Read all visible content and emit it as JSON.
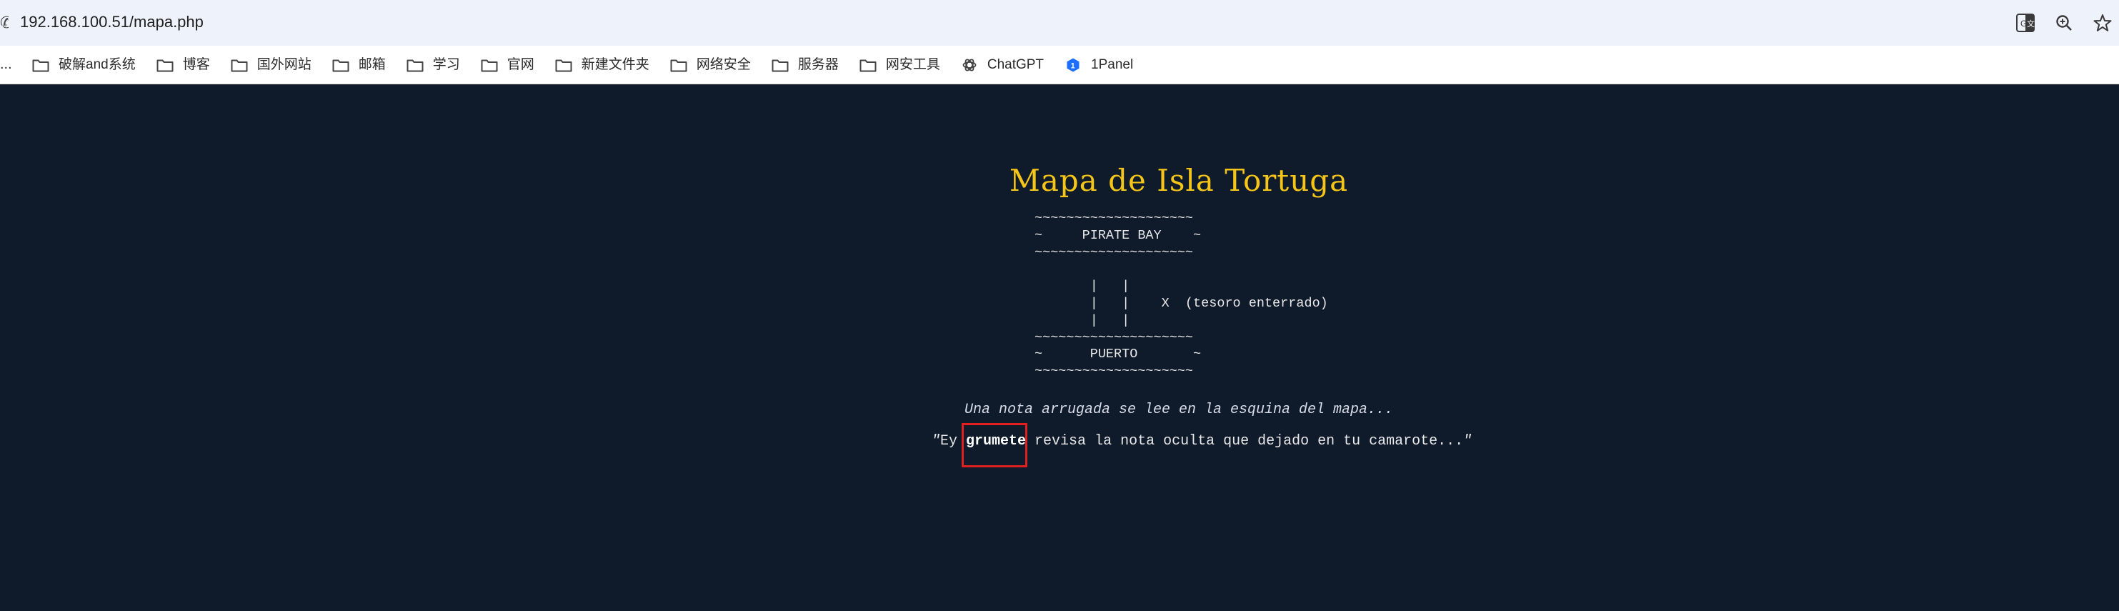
{
  "browser": {
    "url": "192.168.100.51/mapa.php",
    "address_icons": [
      "translate-icon",
      "zoom-icon",
      "bookmark-star-icon"
    ],
    "bookmarks_overflow": "...",
    "bookmarks": [
      {
        "label": "破解and系统",
        "icon": "folder-icon"
      },
      {
        "label": "博客",
        "icon": "folder-icon"
      },
      {
        "label": "国外网站",
        "icon": "folder-icon"
      },
      {
        "label": "邮箱",
        "icon": "folder-icon"
      },
      {
        "label": "学习",
        "icon": "folder-icon"
      },
      {
        "label": "官网",
        "icon": "folder-icon"
      },
      {
        "label": "新建文件夹",
        "icon": "folder-icon"
      },
      {
        "label": "网络安全",
        "icon": "folder-icon"
      },
      {
        "label": "服务器",
        "icon": "folder-icon"
      },
      {
        "label": "网安工具",
        "icon": "folder-icon"
      },
      {
        "label": "ChatGPT",
        "icon": "chatgpt-icon"
      },
      {
        "label": "1Panel",
        "icon": "1panel-icon"
      }
    ]
  },
  "page": {
    "title": "Mapa de Isla Tortuga",
    "ascii_map": "~~~~~~~~~~~~~~~~~~~~\n~     PIRATE BAY    ~\n~~~~~~~~~~~~~~~~~~~~\n\n       |   |\n       |   |    X  (tesoro enterrado)\n       |   |\n~~~~~~~~~~~~~~~~~~~~\n~      PUERTO       ~\n~~~~~~~~~~~~~~~~~~~~",
    "note": "Una nota arrugada se lee en la esquina del mapa...",
    "quote_open": "\"",
    "quote_prefix": "Ey ",
    "quote_highlight": "grumete",
    "quote_suffix": " revisa la nota oculta que dejado en tu camarote...",
    "quote_close": "\""
  },
  "colors": {
    "page_background": "#0f1a2b",
    "title": "#f5c518",
    "highlight_border": "#e02020",
    "address_bar": "#eef2fb"
  }
}
